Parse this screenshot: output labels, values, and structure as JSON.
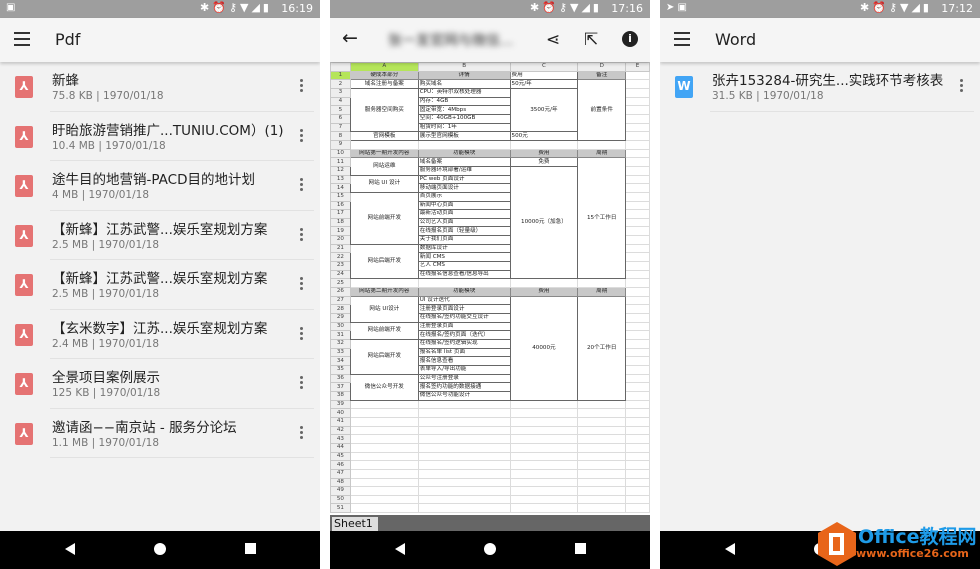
{
  "left": {
    "status": {
      "time": "16:19"
    },
    "title": "Pdf",
    "files": [
      {
        "name": "新蜂",
        "meta": "75.8 KB | 1970/01/18"
      },
      {
        "name": "盱眙旅游营销推广...TUNIU.COM）(1)",
        "meta": "10.4 MB | 1970/01/18"
      },
      {
        "name": "途牛目的地营销-PACD目的地计划",
        "meta": "4 MB | 1970/01/18"
      },
      {
        "name": "【新蜂】江苏武警...娱乐室规划方案",
        "meta": "2.5 MB | 1970/01/18"
      },
      {
        "name": "【新蜂】江苏武警...娱乐室规划方案",
        "meta": "2.5 MB | 1970/01/18"
      },
      {
        "name": "【玄米数字】江苏...娱乐室规划方案",
        "meta": "2.4 MB | 1970/01/18"
      },
      {
        "name": "全景项目案例展示",
        "meta": "125 KB | 1970/01/18"
      },
      {
        "name": "邀请函−−南京站 - 服务分论坛",
        "meta": "1.1 MB | 1970/01/18"
      }
    ]
  },
  "middle": {
    "status": {
      "time": "17:16"
    },
    "title": "张一发官网与微信...",
    "columns": [
      "A",
      "B",
      "C",
      "D",
      "E"
    ],
    "sheet_tab": "Sheet1",
    "rows": {
      "1": [
        {
          "c": "A",
          "t": "硬成本部分",
          "h": 1
        },
        {
          "c": "B",
          "t": "详情",
          "h": 1
        },
        {
          "c": "C",
          "t": "费用",
          "h": 1
        },
        {
          "c": "D",
          "t": "备注",
          "h": 1
        }
      ],
      "2": [
        {
          "c": "A",
          "t": "域名注册与备案"
        },
        {
          "c": "B",
          "t": "购买域名"
        },
        {
          "c": "C",
          "t": "50元/年"
        },
        {
          "c": "D",
          "t": "前置条件",
          "rs": 7
        }
      ],
      "3": [
        {
          "c": "A",
          "t": "服务器空间购买",
          "rs": 5
        },
        {
          "c": "B",
          "t": "CPU：英特尔双核处理器"
        },
        {
          "c": "C",
          "t": "3500元/年",
          "rs": 5
        }
      ],
      "4": [
        {
          "c": "B",
          "t": "内存：4GB"
        }
      ],
      "5": [
        {
          "c": "B",
          "t": "固定带宽：4Mbps"
        }
      ],
      "6": [
        {
          "c": "B",
          "t": "空间：40GB+100GB"
        }
      ],
      "7": [
        {
          "c": "B",
          "t": "租赁时间：1年"
        }
      ],
      "8": [
        {
          "c": "A",
          "t": "官网模板"
        },
        {
          "c": "B",
          "t": "展示型官网模板"
        },
        {
          "c": "C",
          "t": "500元"
        }
      ],
      "10": [
        {
          "c": "A",
          "t": "网站第一期开发内容",
          "h": 1
        },
        {
          "c": "B",
          "t": "功能模块",
          "h": 1
        },
        {
          "c": "C",
          "t": "费用",
          "h": 1
        },
        {
          "c": "D",
          "t": "周期",
          "h": 1
        }
      ],
      "11": [
        {
          "c": "A",
          "t": "网站运维",
          "rs": 2
        },
        {
          "c": "B",
          "t": "域名备案"
        },
        {
          "c": "C",
          "t": "免费"
        },
        {
          "c": "D",
          "t": "15个工作日",
          "rs": 14
        }
      ],
      "12": [
        {
          "c": "B",
          "t": "服务器环境部署/运维"
        },
        {
          "c": "C",
          "t": "10000元（加急）",
          "rs": 13
        }
      ],
      "13": [
        {
          "c": "A",
          "t": "网站 UI 设计",
          "rs": 2
        },
        {
          "c": "B",
          "t": "PC web 页面设计"
        }
      ],
      "14": [
        {
          "c": "B",
          "t": "移动端页面设计"
        }
      ],
      "15": [
        {
          "c": "A",
          "t": "网站前端开发",
          "rs": 6
        },
        {
          "c": "B",
          "t": "首页展示"
        }
      ],
      "16": [
        {
          "c": "B",
          "t": "新闻中心页面"
        }
      ],
      "17": [
        {
          "c": "B",
          "t": "最新活动页面"
        }
      ],
      "18": [
        {
          "c": "B",
          "t": "公司艺人页面"
        }
      ],
      "19": [
        {
          "c": "B",
          "t": "在线报名页面（轻量级）"
        }
      ],
      "20": [
        {
          "c": "B",
          "t": "关于我们页面"
        }
      ],
      "21": [
        {
          "c": "A",
          "t": "网站后端开发",
          "rs": 4
        },
        {
          "c": "B",
          "t": "数据库设计"
        }
      ],
      "22": [
        {
          "c": "B",
          "t": "新闻 CMS"
        }
      ],
      "23": [
        {
          "c": "B",
          "t": "艺人 CMS"
        }
      ],
      "24": [
        {
          "c": "B",
          "t": "在线报名信息查看/信息导出"
        }
      ],
      "26": [
        {
          "c": "A",
          "t": "网站第二期开发内容",
          "h": 1
        },
        {
          "c": "B",
          "t": "功能模块",
          "h": 1
        },
        {
          "c": "C",
          "t": "费用",
          "h": 1
        },
        {
          "c": "D",
          "t": "周期",
          "h": 1
        }
      ],
      "27": [
        {
          "c": "A",
          "t": "网站 UI设计",
          "rs": 3
        },
        {
          "c": "B",
          "t": "UI 设计迭代"
        },
        {
          "c": "C",
          "t": "40000元",
          "rs": 12
        },
        {
          "c": "D",
          "t": "20个工作日",
          "rs": 12
        }
      ],
      "28": [
        {
          "c": "B",
          "t": "注册登录页面设计"
        }
      ],
      "29": [
        {
          "c": "B",
          "t": "在线报名/签约功能交互设计"
        }
      ],
      "30": [
        {
          "c": "A",
          "t": "网站前端开发",
          "rs": 2
        },
        {
          "c": "B",
          "t": "注册登录页面"
        }
      ],
      "31": [
        {
          "c": "B",
          "t": "在线报名/签约页面（迭代）"
        }
      ],
      "32": [
        {
          "c": "A",
          "t": "网站后端开发",
          "rs": 4
        },
        {
          "c": "B",
          "t": "在线报名/签约逻辑实现"
        }
      ],
      "33": [
        {
          "c": "B",
          "t": "报名名单 list 页面"
        }
      ],
      "34": [
        {
          "c": "B",
          "t": "报名信息查看"
        }
      ],
      "35": [
        {
          "c": "B",
          "t": "表单导入/导出功能"
        }
      ],
      "36": [
        {
          "c": "A",
          "t": "微信公众号开发",
          "rs": 3
        },
        {
          "c": "B",
          "t": "公众号注册登录"
        }
      ],
      "37": [
        {
          "c": "B",
          "t": "报名签约功能的数据接通"
        }
      ],
      "38": [
        {
          "c": "B",
          "t": "微信公众号功能设计"
        }
      ]
    },
    "row_count": 51
  },
  "right": {
    "status": {
      "time": "17:12"
    },
    "title": "Word",
    "files": [
      {
        "name": "张卉153284-研究生...实践环节考核表",
        "meta": "31.5 KB | 1970/01/18"
      }
    ]
  },
  "watermark": {
    "line1": "Office教程网",
    "line2": "www.office26.com"
  },
  "colors": {
    "pdf": "#e57373",
    "word": "#42a5f5",
    "selected_cell": "#b5e55a"
  }
}
